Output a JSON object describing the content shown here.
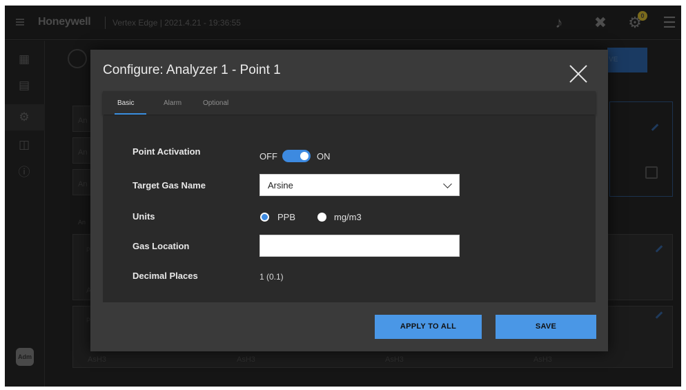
{
  "app": {
    "brand": "Honeywell",
    "device_info": "Vertex Edge | 2021.4.21 - 19:36:55",
    "notification_badge": "0",
    "avatar_label": "Adm",
    "background_save_label": "VE",
    "background_cells": [
      "An",
      "An",
      "An",
      "An",
      "Pc",
      "A",
      "Pc",
      "AsH3",
      "AsH3",
      "AsH3",
      "AsH3"
    ]
  },
  "modal": {
    "title": "Configure: Analyzer 1 - Point 1",
    "tabs": [
      {
        "label": "Basic",
        "active": true
      },
      {
        "label": "Alarm",
        "active": false
      },
      {
        "label": "Optional",
        "active": false
      }
    ],
    "fields": {
      "point_activation": {
        "label": "Point Activation",
        "off_label": "OFF",
        "on_label": "ON",
        "value": true
      },
      "target_gas_name": {
        "label": "Target Gas Name",
        "value": "Arsine"
      },
      "units": {
        "label": "Units",
        "options": [
          "PPB",
          "mg/m3"
        ],
        "selected": "PPB"
      },
      "gas_location": {
        "label": "Gas Location",
        "value": ""
      },
      "decimal_places": {
        "label": "Decimal Places",
        "value": "1 (0.1)"
      }
    },
    "buttons": {
      "apply_to_all": "APPLY TO ALL",
      "save": "SAVE"
    }
  },
  "colors": {
    "accent": "#3d8ae0",
    "button": "#4a97e6",
    "modal_bg": "#3a3a3a",
    "content_bg": "#2a2a2a"
  }
}
